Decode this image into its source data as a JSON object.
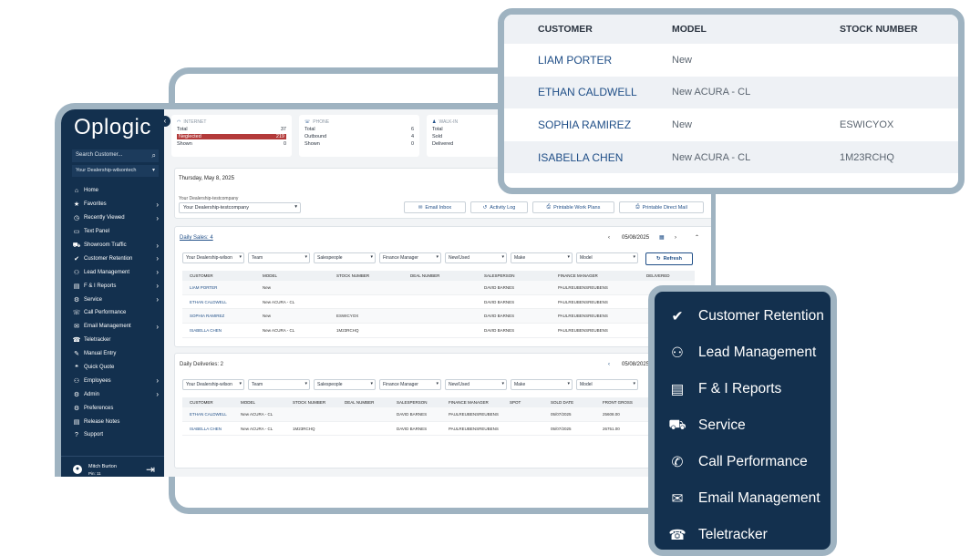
{
  "brand": {
    "logo": "Oplogic"
  },
  "sidebar": {
    "search_placeholder": "Search Customer...",
    "dealership": "Your Dealership-wilsontech",
    "items": [
      {
        "label": "Home",
        "icon": "home-icon",
        "chevron": false
      },
      {
        "label": "Favorites",
        "icon": "star-icon",
        "chevron": true
      },
      {
        "label": "Recently Viewed",
        "icon": "clock-icon",
        "chevron": true
      },
      {
        "label": "Text Panel",
        "icon": "message-icon",
        "chevron": false
      },
      {
        "label": "Showroom Traffic",
        "icon": "car-icon",
        "chevron": true
      },
      {
        "label": "Customer Retention",
        "icon": "user-check-icon",
        "chevron": true
      },
      {
        "label": "Lead Management",
        "icon": "users-icon",
        "chevron": true
      },
      {
        "label": "F & I Reports",
        "icon": "reports-icon",
        "chevron": true
      },
      {
        "label": "Service",
        "icon": "service-icon",
        "chevron": true
      },
      {
        "label": "Call Performance",
        "icon": "phone-icon",
        "chevron": false
      },
      {
        "label": "Email Management",
        "icon": "mail-icon",
        "chevron": true
      },
      {
        "label": "Teletracker",
        "icon": "phone-tracker-icon",
        "chevron": false
      },
      {
        "label": "Manual Entry",
        "icon": "edit-icon",
        "chevron": false
      },
      {
        "label": "Quick Quote",
        "icon": "quote-icon",
        "chevron": false
      },
      {
        "label": "Employees",
        "icon": "employees-icon",
        "chevron": true
      },
      {
        "label": "Admin",
        "icon": "admin-icon",
        "chevron": true
      },
      {
        "label": "Preferences",
        "icon": "gear-icon",
        "chevron": false
      },
      {
        "label": "Release Notes",
        "icon": "notes-icon",
        "chevron": false
      },
      {
        "label": "Support",
        "icon": "support-icon",
        "chevron": false
      }
    ],
    "user": {
      "name": "Mitch Burton",
      "sub": "Pin: 11"
    }
  },
  "stats": [
    {
      "title": "INTERNET",
      "icon": "wifi-icon",
      "rows": [
        {
          "label": "Total",
          "value": "37"
        },
        {
          "label": "Neglected",
          "value": "219",
          "highlight": true
        },
        {
          "label": "Shown",
          "value": "0"
        }
      ]
    },
    {
      "title": "PHONE",
      "icon": "phone-icon",
      "rows": [
        {
          "label": "Total",
          "value": "6"
        },
        {
          "label": "Outbound",
          "value": "4"
        },
        {
          "label": "Shown",
          "value": "0"
        }
      ]
    },
    {
      "title": "WALK-IN",
      "icon": "walk-in-icon",
      "rows": [
        {
          "label": "Total",
          "value": ""
        },
        {
          "label": "Sold",
          "value": ""
        },
        {
          "label": "Delivered",
          "value": ""
        }
      ]
    }
  ],
  "header": {
    "date": "Thursday, May 8, 2025",
    "dealer_label": "Your Dealership-testcompany",
    "dealer_value": "Your Dealership-testcompany",
    "buttons": [
      "Email Inbox",
      "Activity Log",
      "Printable Work Plans",
      "Printable Direct Mail"
    ]
  },
  "filters": [
    "Your Dealership-wilson",
    "Team",
    "Salespeople",
    "Finance Manager",
    "New/Used",
    "Make",
    "Model"
  ],
  "sales": {
    "title": "Daily Sales: 4",
    "date": "05/08/2025",
    "refresh": "Refresh",
    "columns": [
      "CUSTOMER",
      "MODEL",
      "STOCK NUMBER",
      "DEAL NUMBER",
      "SALESPERSON",
      "FINANCE MANAGER",
      "DELIVERED"
    ],
    "rows": [
      [
        "LIAM PORTER",
        "New",
        "",
        "",
        "DAVID BARNES",
        "PAULREUBENSREUBENS",
        ""
      ],
      [
        "ETHAN CALDWELL",
        "New ACURA - CL",
        "",
        "",
        "DAVID BARNES",
        "PAULREUBENSREUBENS",
        ""
      ],
      [
        "SOPHIA RAMIREZ",
        "New",
        "ESWICYOX",
        "",
        "DAVID BARNES",
        "PAULREUBENSREUBENS",
        ""
      ],
      [
        "ISABELLA CHEN",
        "New ACURA - CL",
        "1M23RCHQ",
        "",
        "DAVID BARNES",
        "PAULREUBENSREUBENS",
        ""
      ]
    ]
  },
  "deliveries": {
    "title": "Daily Deliveries: 2",
    "date": "05/08/2025",
    "columns": [
      "CUSTOMER",
      "MODEL",
      "STOCK NUMBER",
      "DEAL NUMBER",
      "SALESPERSON",
      "FINANCE MANAGER",
      "SPOT",
      "SOLD DATE",
      "FRONT GROSS"
    ],
    "rows": [
      [
        "ETHAN CALDWELL",
        "New ACURA - CL",
        "",
        "",
        "DAVID BARNES",
        "PAULREUBENSREUBENS",
        "",
        "05/07/2025",
        "25608.00"
      ],
      [
        "ISABELLA CHEN",
        "New ACURA - CL",
        "1M23RCHQ",
        "",
        "DAVID BARNES",
        "PAULREUBENSREUBENS",
        "",
        "05/07/2025",
        "26751.00"
      ]
    ]
  },
  "popup_table": {
    "columns": [
      "CUSTOMER",
      "MODEL",
      "STOCK NUMBER"
    ],
    "rows": [
      [
        "LIAM PORTER",
        "New",
        ""
      ],
      [
        "ETHAN CALDWELL",
        "New ACURA - CL",
        ""
      ],
      [
        "SOPHIA RAMIREZ",
        "New",
        "ESWICYOX"
      ],
      [
        "ISABELLA CHEN",
        "New ACURA - CL",
        "1M23RCHQ"
      ]
    ]
  },
  "popup_menu": [
    {
      "label": "Customer Retention",
      "icon": "user-check-icon"
    },
    {
      "label": "Lead Management",
      "icon": "users-icon"
    },
    {
      "label": "F & I Reports",
      "icon": "reports-icon"
    },
    {
      "label": "Service",
      "icon": "service-icon"
    },
    {
      "label": "Call Performance",
      "icon": "phone-icon"
    },
    {
      "label": "Email Management",
      "icon": "mail-icon"
    },
    {
      "label": "Teletracker",
      "icon": "phone-tracker-icon"
    }
  ],
  "colors": {
    "navy": "#13304e",
    "frame": "#9fb3c1",
    "link": "#1f4e87",
    "neglected": "#b33a3a"
  }
}
